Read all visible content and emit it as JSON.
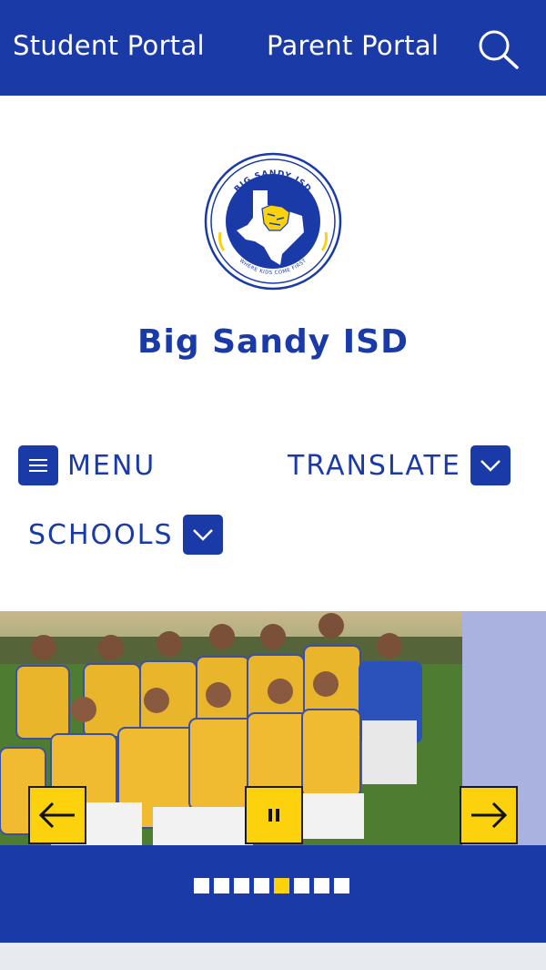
{
  "header": {
    "student_portal": "Student Portal",
    "parent_portal": "Parent Portal",
    "search_icon": "search-icon"
  },
  "logo": {
    "top_text": "BIG SANDY ISD",
    "bottom_text": "WHERE KIDS COME FIRST"
  },
  "site_name": "Big Sandy ISD",
  "nav": {
    "menu_label": "MENU",
    "translate_label": "TRANSLATE",
    "schools_label": "SCHOOLS"
  },
  "slideshow": {
    "slide_count": 8,
    "active_slide": 5,
    "prev_icon": "arrow-left-icon",
    "pause_icon": "pause-icon",
    "next_icon": "arrow-right-icon"
  },
  "colors": {
    "brand_blue": "#1a3aa8",
    "accent_yellow": "#fcd20c",
    "footer_gray": "#e7ebf0"
  }
}
